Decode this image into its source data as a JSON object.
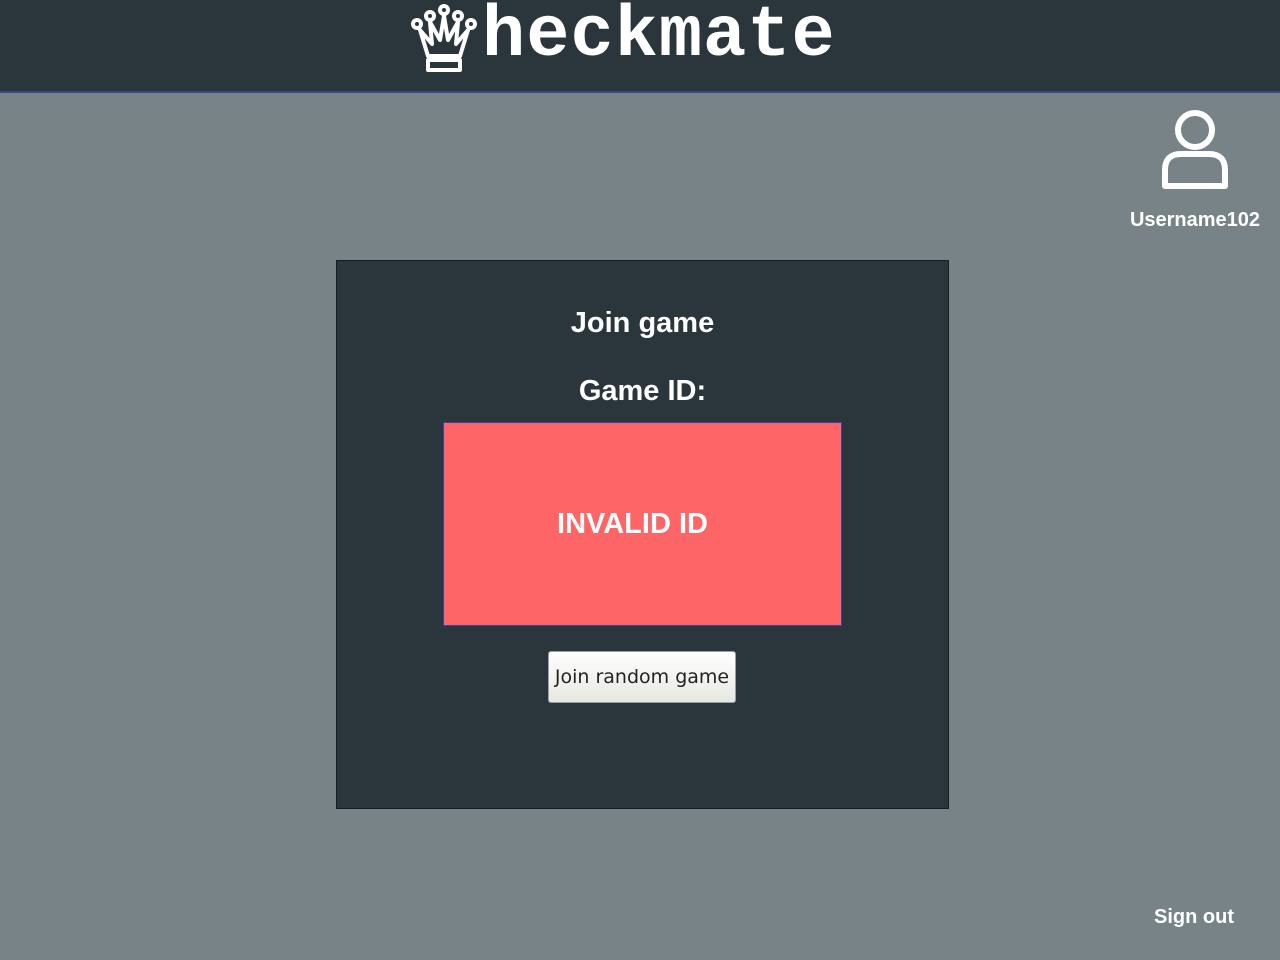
{
  "header": {
    "logo_text": "heckmate",
    "logo_icon": "queen-crown-icon"
  },
  "user": {
    "icon": "user-avatar-icon",
    "username": "Username102"
  },
  "panel": {
    "title": "Join game",
    "game_id_label": "Game ID:",
    "error_text": "INVALID ID",
    "join_random_label": "Join random game"
  },
  "footer": {
    "sign_out_label": "Sign out"
  },
  "colors": {
    "background": "#778387",
    "header": "#2b363c",
    "panel": "#2b363c",
    "error": "#fe6566",
    "text": "#ffffff"
  }
}
